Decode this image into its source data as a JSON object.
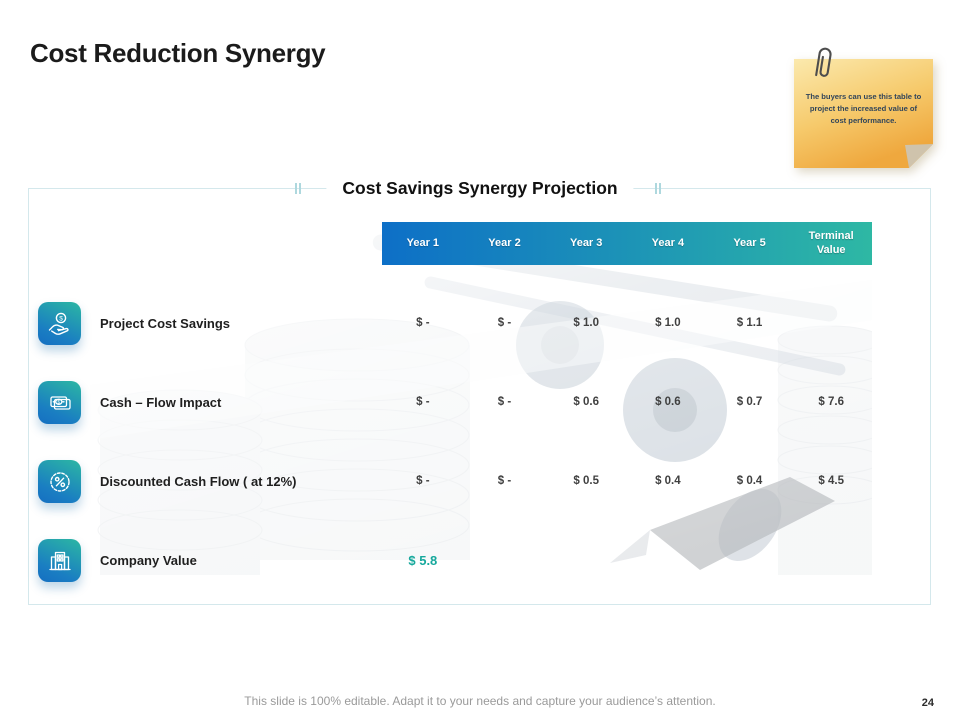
{
  "slide": {
    "title": "Cost Reduction Synergy",
    "footer": "This slide is 100% editable. Adapt it to your needs and capture your audience’s attention.",
    "page_number": "24"
  },
  "sticky_note": {
    "text": "The buyers can use this table to project the increased value of cost performance."
  },
  "table": {
    "title": "Cost Savings Synergy Projection",
    "columns": [
      "Year 1",
      "Year 2",
      "Year 3",
      "Year 4",
      "Year 5",
      "Terminal Value"
    ],
    "rows": [
      {
        "icon": "hand-coin-icon",
        "label": "Project Cost Savings",
        "values": [
          "$ -",
          "$ -",
          "$ 1.0",
          "$ 1.0",
          "$ 1.1",
          ""
        ]
      },
      {
        "icon": "cash-icon",
        "label": "Cash – Flow Impact",
        "values": [
          "$ -",
          "$ -",
          "$ 0.6",
          "$ 0.6",
          "$ 0.7",
          "$ 7.6"
        ]
      },
      {
        "icon": "percent-badge-icon",
        "label": "Discounted Cash Flow ( at 12%)",
        "values": [
          "$ -",
          "$ -",
          "$ 0.5",
          "$ 0.4",
          "$ 0.4",
          "$ 4.5"
        ]
      },
      {
        "icon": "building-icon",
        "label": "Company Value",
        "values": [
          "$ 5.8",
          "",
          "",
          "",
          "",
          ""
        ]
      }
    ]
  },
  "colors": {
    "header_gradient_start": "#0d6fc7",
    "header_gradient_end": "#2eb8a4",
    "accent_teal": "#16a89c",
    "note_top": "#fbe8a9",
    "note_bottom": "#efa83e",
    "frame_border": "#d4e8ec"
  }
}
